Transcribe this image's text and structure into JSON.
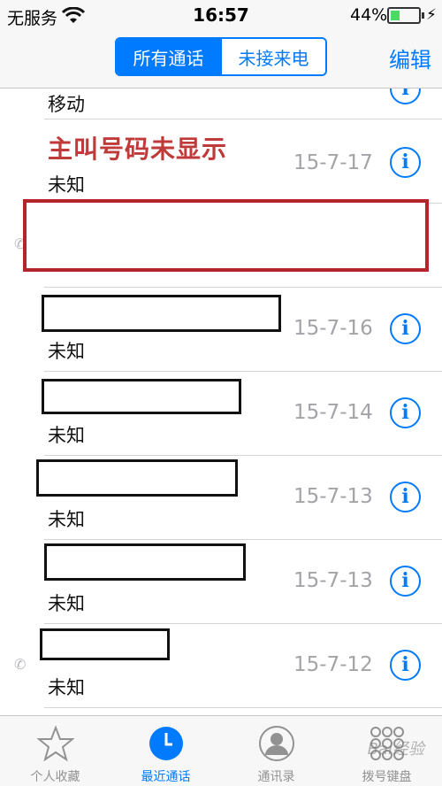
{
  "status_bar": {
    "carrier": "无服务",
    "time": "16:57",
    "battery": "44%"
  },
  "nav": {
    "segments": [
      "所有通话",
      "未接来电"
    ],
    "edit_label": "编辑"
  },
  "annotation": "主叫号码未显示",
  "top_row": {
    "type": "移动"
  },
  "calls": [
    {
      "type": "未知",
      "date": "15-7-17"
    },
    {
      "type": "",
      "date": ""
    },
    {
      "type": "未知",
      "date": "15-7-16"
    },
    {
      "type": "未知",
      "date": "15-7-14"
    },
    {
      "type": "未知",
      "date": "15-7-13"
    },
    {
      "type": "未知",
      "date": "15-7-13"
    },
    {
      "type": "未知",
      "date": "15-7-12"
    }
  ],
  "tabs": [
    {
      "label": "个人收藏",
      "icon": "star-icon"
    },
    {
      "label": "最近通话",
      "icon": "clock-icon"
    },
    {
      "label": "通讯录",
      "icon": "contact-icon"
    },
    {
      "label": "拨号键盘",
      "icon": "keypad-icon"
    }
  ],
  "colors": {
    "accent": "#007aff",
    "annotation": "#c03a3a",
    "highlight_border": "#b4242b",
    "date_gray": "#a3a3a8"
  },
  "watermark": "Bai经验"
}
